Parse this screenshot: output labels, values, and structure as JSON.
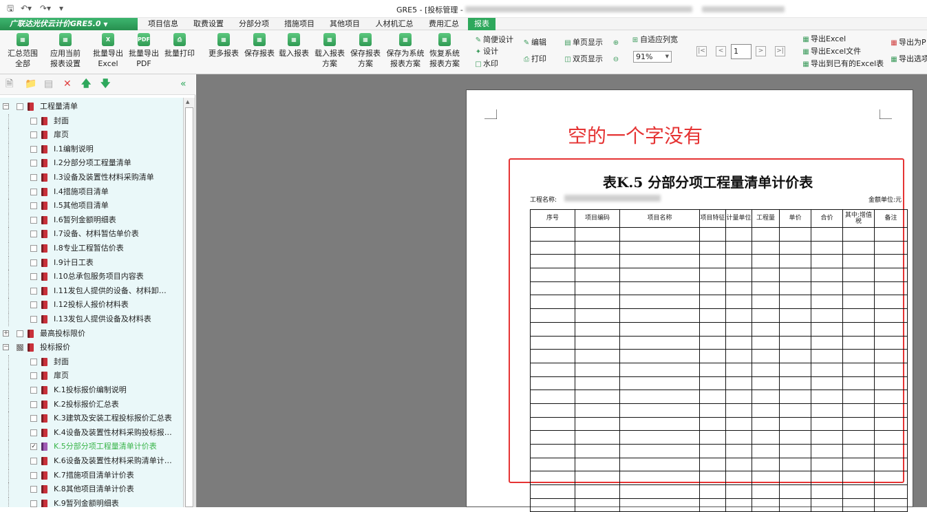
{
  "window": {
    "title": "GRE5 - [投标管理 -"
  },
  "quick_access": {
    "save_icon": "save-icon",
    "undo_icon": "undo-icon",
    "redo_icon": "redo-icon"
  },
  "menubar": {
    "app_name": "广联达光伏云计价GRE5.0",
    "tabs": [
      "项目信息",
      "取费设置",
      "分部分项",
      "措施项目",
      "其他项目",
      "人材机汇总",
      "费用汇总",
      "报表"
    ],
    "active_tab": "报表"
  },
  "ribbon": {
    "big_buttons": [
      {
        "line1": "汇总范围",
        "line2": "全部",
        "icon": "summary-icon"
      },
      {
        "line1": "应用当前",
        "line2": "报表设置",
        "icon": "apply-settings-icon"
      },
      {
        "line1": "批量导出",
        "line2": "Excel",
        "icon": "batch-excel-icon"
      },
      {
        "line1": "批量导出",
        "line2": "PDF",
        "icon": "batch-pdf-icon"
      },
      {
        "line1": "批量打印",
        "line2": "",
        "icon": "batch-print-icon"
      },
      {
        "line1": "更多报表",
        "line2": "",
        "icon": "more-reports-icon"
      },
      {
        "line1": "保存报表",
        "line2": "",
        "icon": "save-report-icon"
      },
      {
        "line1": "载入报表",
        "line2": "",
        "icon": "load-report-icon"
      },
      {
        "line1": "载入报表",
        "line2": "方案",
        "icon": "load-scheme-icon"
      },
      {
        "line1": "保存报表",
        "line2": "方案",
        "icon": "save-scheme-icon"
      },
      {
        "line1": "保存为系统",
        "line2": "报表方案",
        "icon": "save-system-scheme-icon"
      },
      {
        "line1": "恢复系统",
        "line2": "报表方案",
        "icon": "restore-system-scheme-icon"
      }
    ],
    "design_group": {
      "simple_design": "简便设计",
      "design": "设计",
      "watermark": "水印",
      "edit": "编辑",
      "print": "打印"
    },
    "view_group": {
      "single_page": "单页显示",
      "double_page": "双页显示",
      "fit_width": "自适应列宽",
      "zoom": "91%"
    },
    "nav_group": {
      "page": "1"
    },
    "export_group": {
      "export_excel": "导出Excel",
      "export_excel_file": "导出Excel文件",
      "export_existing_excel": "导出到已有的Excel表",
      "export_pdf": "导出为P",
      "export_options": "导出选项"
    }
  },
  "tree": {
    "items": [
      {
        "level": 0,
        "label": "工程量清单",
        "expander": "⊟",
        "check": "none"
      },
      {
        "level": 1,
        "label": "封面",
        "check": "none"
      },
      {
        "level": 1,
        "label": "扉页",
        "check": "none"
      },
      {
        "level": 1,
        "label": "I.1编制说明",
        "check": "none"
      },
      {
        "level": 1,
        "label": "I.2分部分项工程量清单",
        "check": "none"
      },
      {
        "level": 1,
        "label": "I.3设备及装置性材料采购清单",
        "check": "none"
      },
      {
        "level": 1,
        "label": "I.4措施项目清单",
        "check": "none"
      },
      {
        "level": 1,
        "label": "I.5其他项目清单",
        "check": "none"
      },
      {
        "level": 1,
        "label": "I.6暂列金额明细表",
        "check": "none"
      },
      {
        "level": 1,
        "label": "I.7设备、材料暂估单价表",
        "check": "none"
      },
      {
        "level": 1,
        "label": "I.8专业工程暂估价表",
        "check": "none"
      },
      {
        "level": 1,
        "label": "I.9计日工表",
        "check": "none"
      },
      {
        "level": 1,
        "label": "I.10总承包服务项目内容表",
        "check": "none"
      },
      {
        "level": 1,
        "label": "I.11发包人提供的设备、材料卸…",
        "check": "none"
      },
      {
        "level": 1,
        "label": "I.12投标人报价材料表",
        "check": "none"
      },
      {
        "level": 1,
        "label": "I.13发包人提供设备及材料表",
        "check": "none"
      },
      {
        "level": 0,
        "label": "最高投标限价",
        "expander": "⊞",
        "check": "none"
      },
      {
        "level": 0,
        "label": "投标报价",
        "expander": "⊟",
        "check": "partial"
      },
      {
        "level": 1,
        "label": "封面",
        "check": "none"
      },
      {
        "level": 1,
        "label": "扉页",
        "check": "none"
      },
      {
        "level": 1,
        "label": "K.1投标报价编制说明",
        "check": "none"
      },
      {
        "level": 1,
        "label": "K.2投标报价汇总表",
        "check": "none"
      },
      {
        "level": 1,
        "label": "K.3建筑及安装工程投标报价汇总表",
        "check": "none"
      },
      {
        "level": 1,
        "label": "K.4设备及装置性材料采购投标报…",
        "check": "none"
      },
      {
        "level": 1,
        "label": "K.5分部分项工程量清单计价表",
        "check": "checked",
        "selected": true
      },
      {
        "level": 1,
        "label": "K.6设备及装置性材料采购清单计…",
        "check": "none"
      },
      {
        "level": 1,
        "label": "K.7措施项目清单计价表",
        "check": "none"
      },
      {
        "level": 1,
        "label": "K.8其他项目清单计价表",
        "check": "none"
      },
      {
        "level": 1,
        "label": "K.9暂列金额明细表",
        "check": "none"
      }
    ]
  },
  "report": {
    "annotation": "空的一个字没有",
    "title": "表K.5  分部分项工程量清单计价表",
    "project_name_label": "工程名称:",
    "amount_unit_label": "金额单位:元",
    "columns": [
      "序号",
      "项目编码",
      "项目名称",
      "项目特征",
      "计量单位",
      "工程量",
      "单价",
      "合价",
      "其中:增值税",
      "备注"
    ],
    "empty_rows": 21
  },
  "colors": {
    "accent_green": "#2ea85c",
    "annotation_red": "#e53333",
    "tree_bg": "#eaf8f9",
    "viewer_bg": "#7c7c7c"
  }
}
